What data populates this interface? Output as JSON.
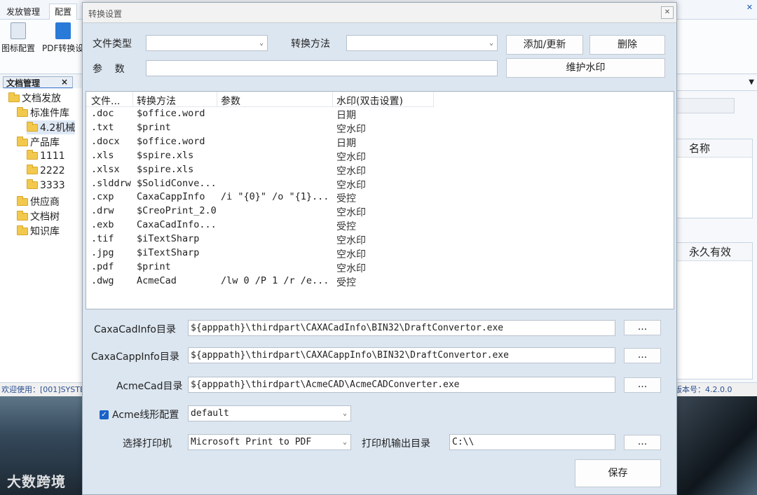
{
  "background": {
    "ribbon_tabs": [
      "发放管理",
      "配置"
    ],
    "ribbon_items": [
      "图标配置",
      "PDF转换设"
    ],
    "doc_tab": "文档管理",
    "tree": [
      {
        "label": "文档发放",
        "level": 0
      },
      {
        "label": "标准件库",
        "level": 1
      },
      {
        "label": "4.2机械",
        "level": 2
      },
      {
        "label": "产品库",
        "level": 1
      },
      {
        "label": "1111",
        "level": 2
      },
      {
        "label": "2222",
        "level": 2
      },
      {
        "label": "3333",
        "level": 2
      },
      {
        "label": "供应商",
        "level": 1
      },
      {
        "label": "文档树",
        "level": 1
      },
      {
        "label": "知识库",
        "level": 1
      }
    ],
    "right_col1": "名称",
    "right_col2": "永久有效",
    "status_left": "欢迎使用：[001]SYSTE",
    "status_right": "版本号：4.2.0.0",
    "desktop_watermark": "大数跨境"
  },
  "dialog": {
    "title": "转换设置",
    "file_type_label": "文件类型",
    "file_type_value": "",
    "method_label": "转换方法",
    "method_value": "",
    "param_label": "参    数",
    "param_value": "",
    "add_update_button": "添加/更新",
    "delete_button": "删除",
    "watermark_button": "维护水印",
    "grid": {
      "columns": [
        "文件...",
        "转换方法",
        "参数",
        "水印(双击设置)"
      ],
      "rows": [
        [
          ".doc",
          "$office.word",
          "",
          "日期"
        ],
        [
          ".txt",
          "$print",
          "",
          "空水印"
        ],
        [
          ".docx",
          "$office.word",
          "",
          "日期"
        ],
        [
          ".xls",
          "$spire.xls",
          "",
          "空水印"
        ],
        [
          ".xlsx",
          "$spire.xls",
          "",
          "空水印"
        ],
        [
          ".slddrw",
          "$SolidConve...",
          "",
          "空水印"
        ],
        [
          ".cxp",
          "CaxaCappInfo",
          "/i \"{0}\" /o \"{1}...",
          "受控"
        ],
        [
          ".drw",
          "$CreoPrint_2.0",
          "",
          "空水印"
        ],
        [
          ".exb",
          "CaxaCadInfo...",
          "",
          "受控"
        ],
        [
          ".tif",
          "$iTextSharp",
          "",
          "空水印"
        ],
        [
          ".jpg",
          "$iTextSharp",
          "",
          "空水印"
        ],
        [
          ".pdf",
          "$print",
          "",
          "空水印"
        ],
        [
          ".dwg",
          "AcmeCad",
          "/lw 0 /P 1 /r /e...",
          "受控"
        ]
      ]
    },
    "caxa_cad_label": "CaxaCadInfo目录",
    "caxa_cad_path": "${apppath}\\thirdpart\\CAXACadInfo\\BIN32\\DraftConvertor.exe",
    "caxa_capp_label": "CaxaCappInfo目录",
    "caxa_capp_path": "${apppath}\\thirdpart\\CAXACappInfo\\BIN32\\DraftConvertor.exe",
    "acme_label": "AcmeCad目录",
    "acme_path": "${apppath}\\thirdpart\\AcmeCAD\\AcmeCADConverter.exe",
    "browse_label": "...",
    "acme_line_label": "Acme线形配置",
    "acme_line_checked": true,
    "acme_line_value": "default",
    "printer_label": "选择打印机",
    "printer_value": "Microsoft Print to PDF",
    "printer_output_label": "打印机输出目录",
    "printer_output_value": "C:\\\\",
    "save_button": "保存"
  },
  "colors": {
    "accent": "#1b62c7",
    "dialog_bg": "#dce6f0"
  }
}
